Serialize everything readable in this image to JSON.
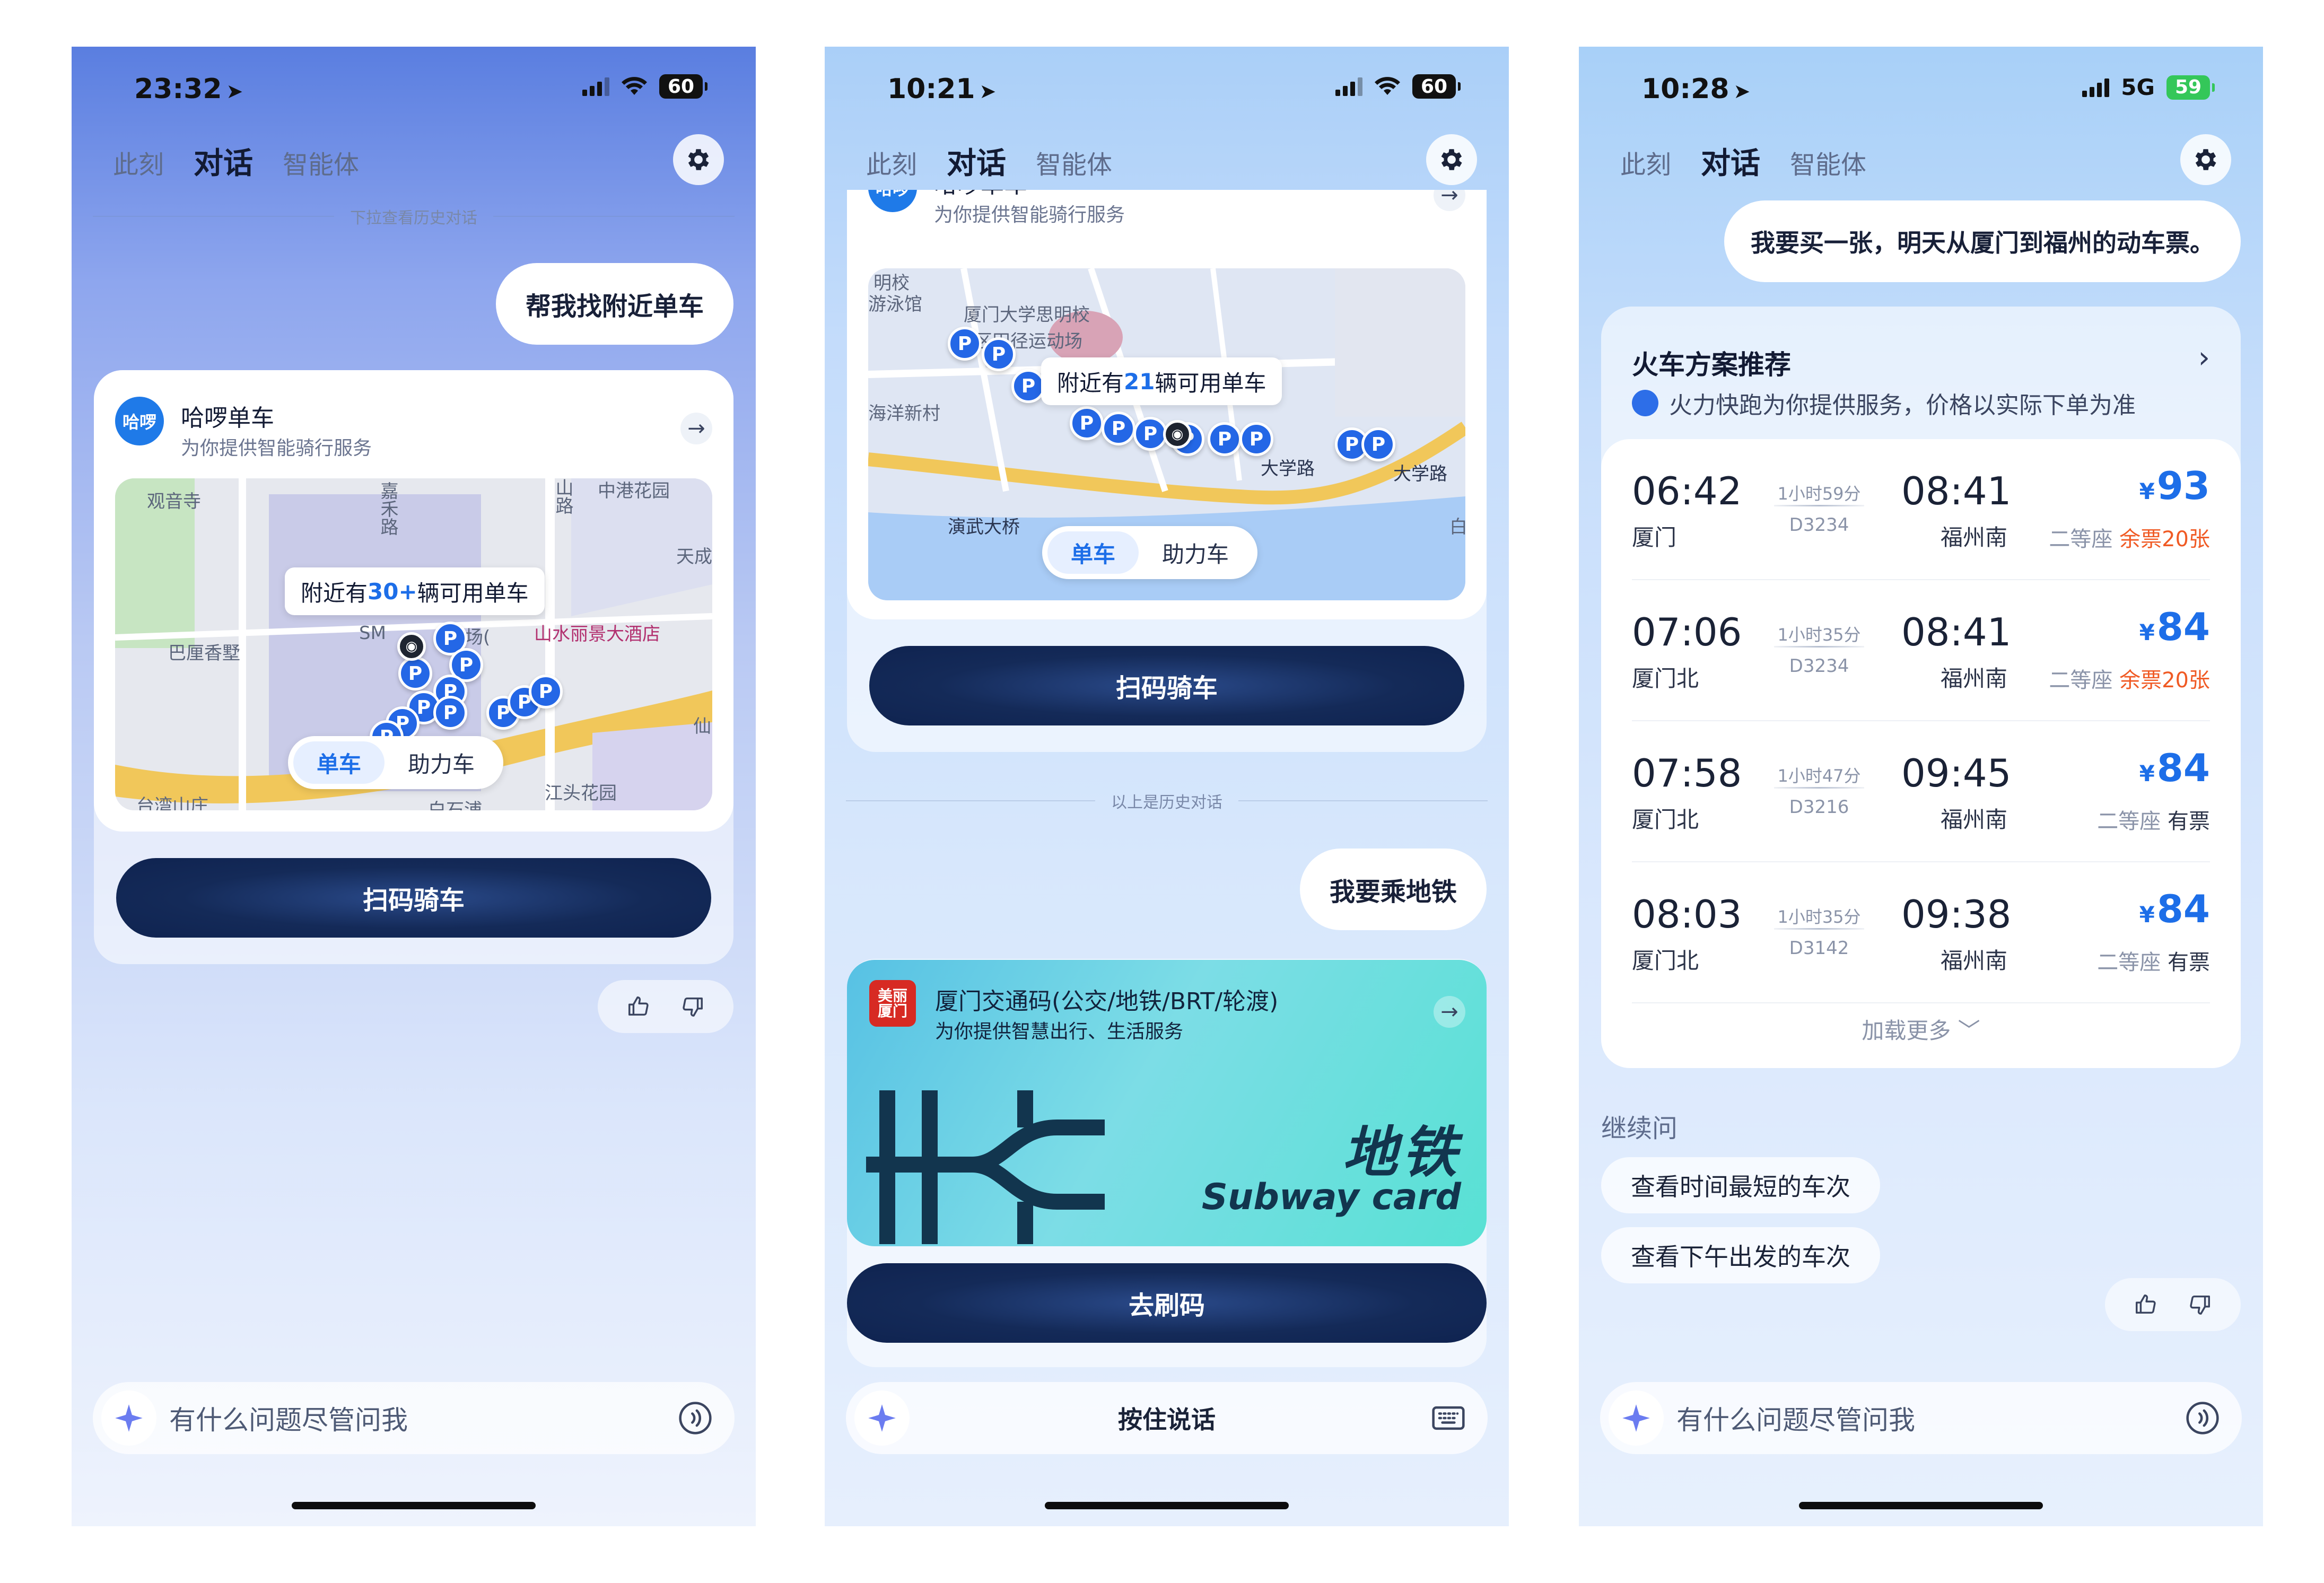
{
  "phones": [
    {
      "status": {
        "time": "23:32",
        "battery": "60"
      },
      "tabs": [
        "此刻",
        "对话",
        "智能体"
      ],
      "pull_hint": "下拉查看历史对话",
      "user_message": "帮我找附近单车",
      "service": {
        "logo_text": "哈啰",
        "name": "哈啰单车",
        "subtitle": "为你提供智能骑行服务"
      },
      "map": {
        "tip_prefix": "附近有",
        "tip_count": "30+",
        "tip_suffix": "辆可用单车",
        "labels": [
          "观音寺",
          "嘉禾路",
          "中港花园",
          "山路",
          "天成",
          "巴厘香墅",
          "SM",
          "场(",
          "山水丽景大酒店",
          "仙",
          "台湾山庄",
          "江头花园",
          "白石浦"
        ],
        "toggle": [
          "单车",
          "助力车"
        ],
        "pin_label": "P"
      },
      "action_button": "扫码骑车",
      "input_placeholder": "有什么问题尽管问我"
    },
    {
      "status": {
        "time": "10:21",
        "battery": "60"
      },
      "tabs": [
        "此刻",
        "对话",
        "智能体"
      ],
      "service": {
        "logo_text": "哈啰",
        "name": "哈啰单车",
        "subtitle": "为你提供智能骑行服务"
      },
      "map": {
        "tip_prefix": "附近有",
        "tip_count": "21",
        "tip_suffix": "辆可用单车",
        "labels": [
          "明校",
          "游泳馆",
          "厦门大学思明校",
          "区田径运动场",
          "海洋新村",
          "演武大桥",
          "大学路",
          "大学路",
          "白"
        ],
        "toggle": [
          "单车",
          "助力车"
        ],
        "pin_label": "P"
      },
      "action_button": "扫码骑车",
      "history_divider": "以上是历史对话",
      "user_message": "我要乘地铁",
      "service2": {
        "logo_text": "美丽厦门",
        "name": "厦门交通码(公交/地铁/BRT/轮渡)",
        "subtitle": "为你提供智慧出行、生活服务"
      },
      "subway": {
        "title_cn": "地铁",
        "title_en": "Subway card"
      },
      "action_button2": "去刷码",
      "input_voice_label": "按住说话"
    },
    {
      "status": {
        "time": "10:28",
        "network": "5G",
        "battery": "59"
      },
      "tabs": [
        "此刻",
        "对话",
        "智能体"
      ],
      "user_message": "我要买一张，明天从厦门到福州的动车票。",
      "train": {
        "title": "火车方案推荐",
        "subtitle": "火力快跑为你提供服务，价格以实际下单为准",
        "currency": "¥",
        "rows": [
          {
            "dep_time": "06:42",
            "dep_station": "厦门",
            "duration": "1小时59分",
            "code": "D3234",
            "arr_time": "08:41",
            "arr_station": "福州南",
            "price": "93",
            "seat": "二等座",
            "avail": "余票20张",
            "avail_type": "left"
          },
          {
            "dep_time": "07:06",
            "dep_station": "厦门北",
            "duration": "1小时35分",
            "code": "D3234",
            "arr_time": "08:41",
            "arr_station": "福州南",
            "price": "84",
            "seat": "二等座",
            "avail": "余票20张",
            "avail_type": "left"
          },
          {
            "dep_time": "07:58",
            "dep_station": "厦门北",
            "duration": "1小时47分",
            "code": "D3216",
            "arr_time": "09:45",
            "arr_station": "福州南",
            "price": "84",
            "seat": "二等座",
            "avail": "有票",
            "avail_type": "have"
          },
          {
            "dep_time": "08:03",
            "dep_station": "厦门北",
            "duration": "1小时35分",
            "code": "D3142",
            "arr_time": "09:38",
            "arr_station": "福州南",
            "price": "84",
            "seat": "二等座",
            "avail": "有票",
            "avail_type": "have"
          }
        ],
        "load_more": "加载更多 ﹀"
      },
      "follow_up_label": "继续问",
      "follow_ups": [
        "查看时间最短的车次",
        "查看下午出发的车次"
      ],
      "input_placeholder": "有什么问题尽管问我"
    }
  ],
  "colors": {
    "accent": "#1d6ee8",
    "button_dark": "#142a58",
    "warning": "#f05a24"
  },
  "icons": [
    "location-arrow-icon",
    "signal-icon",
    "wifi-icon",
    "battery-icon",
    "gear-icon",
    "arrow-right-icon",
    "parking-pin-icon",
    "thumbs-up-icon",
    "thumbs-down-icon",
    "sparkle-icon",
    "voice-icon",
    "keyboard-icon",
    "chevron-right-icon"
  ]
}
